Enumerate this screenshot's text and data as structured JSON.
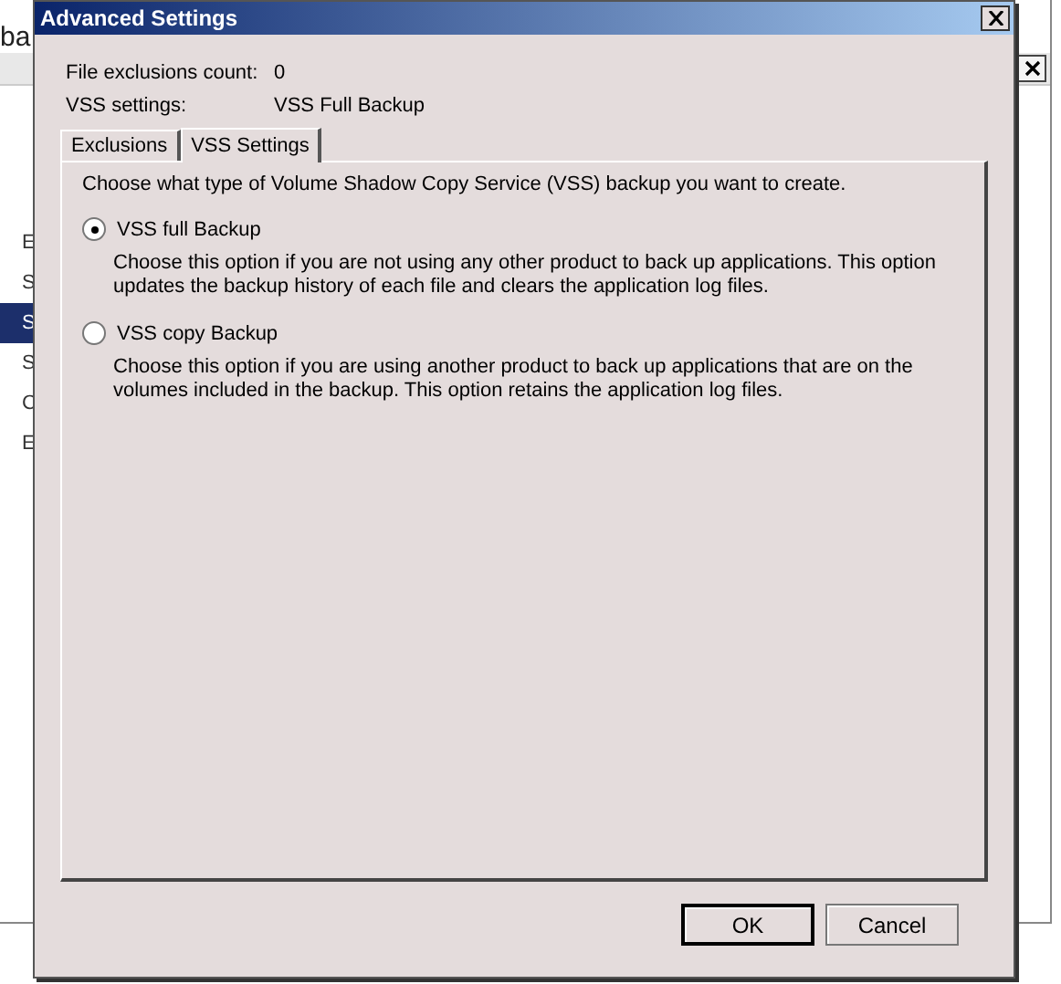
{
  "background_window": {
    "title": "ba",
    "sidebar": [
      {
        "label": "E",
        "selected": false
      },
      {
        "label": "S",
        "selected": false
      },
      {
        "label": "S",
        "selected": true
      },
      {
        "label": "S",
        "selected": false
      },
      {
        "label": "C",
        "selected": false
      },
      {
        "label": "E",
        "selected": false
      }
    ]
  },
  "window": {
    "title": "Advanced Settings"
  },
  "summary": [
    {
      "label": "File exclusions count:",
      "value": "0"
    },
    {
      "label": "VSS settings:",
      "value": "VSS Full Backup"
    }
  ],
  "tabs": [
    {
      "label": "Exclusions",
      "selected": false
    },
    {
      "label": "VSS Settings",
      "selected": true
    }
  ],
  "intro": "Choose what type of Volume Shadow Copy Service (VSS) backup you want to create.",
  "options": [
    {
      "label": "VSS full Backup",
      "selected": true,
      "description": "Choose this option if you are not using any other product to back up applications. This option updates the backup history of each file and clears the application log files."
    },
    {
      "label": "VSS copy Backup",
      "selected": false,
      "description": "Choose this option if you are using another product to back up applications that are on the volumes included in the backup. This option retains the application log files."
    }
  ],
  "buttons": [
    {
      "label": "OK",
      "default": true
    },
    {
      "label": "Cancel",
      "default": false
    }
  ]
}
